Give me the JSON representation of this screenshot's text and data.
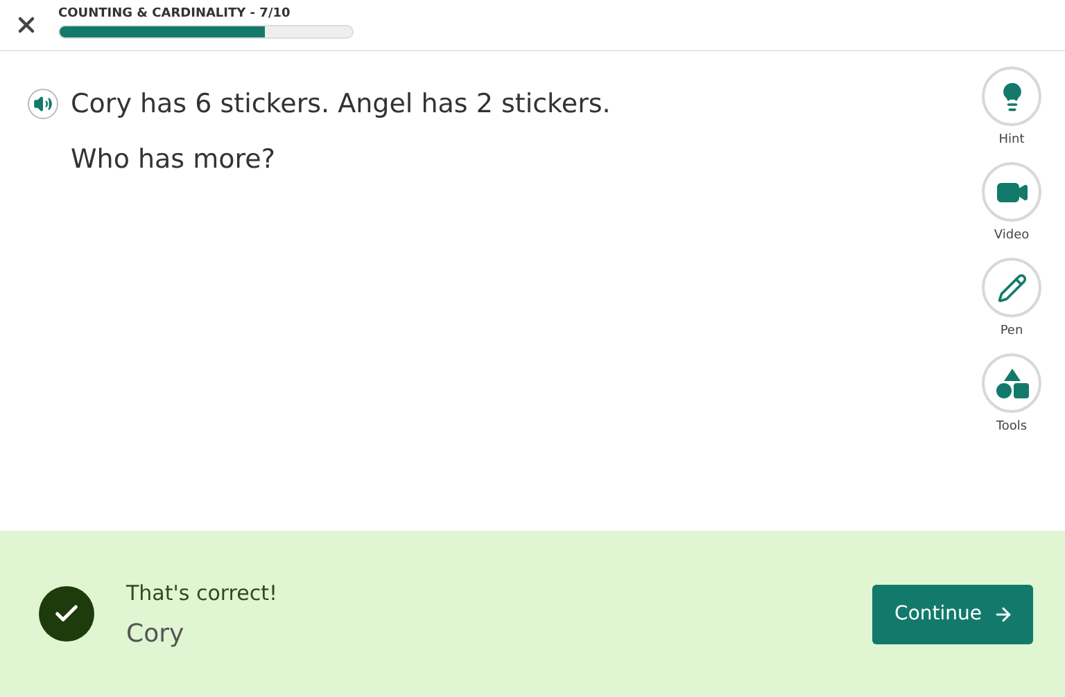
{
  "header": {
    "title": "COUNTING & CARDINALITY - 7/10",
    "progress": {
      "level": 0.7
    }
  },
  "question": {
    "lines": [
      "Cory has 6 stickers. Angel has 2 stickers.",
      "Who has more?"
    ]
  },
  "tools": [
    {
      "kind": "hint",
      "label": "Hint"
    },
    {
      "kind": "video",
      "label": "Video"
    },
    {
      "kind": "pen",
      "label": "Pen"
    },
    {
      "kind": "shapes",
      "label": "Tools"
    }
  ],
  "feedback": {
    "correct": true,
    "message": "That's correct!",
    "answer": "Cory",
    "button": "Continue"
  }
}
